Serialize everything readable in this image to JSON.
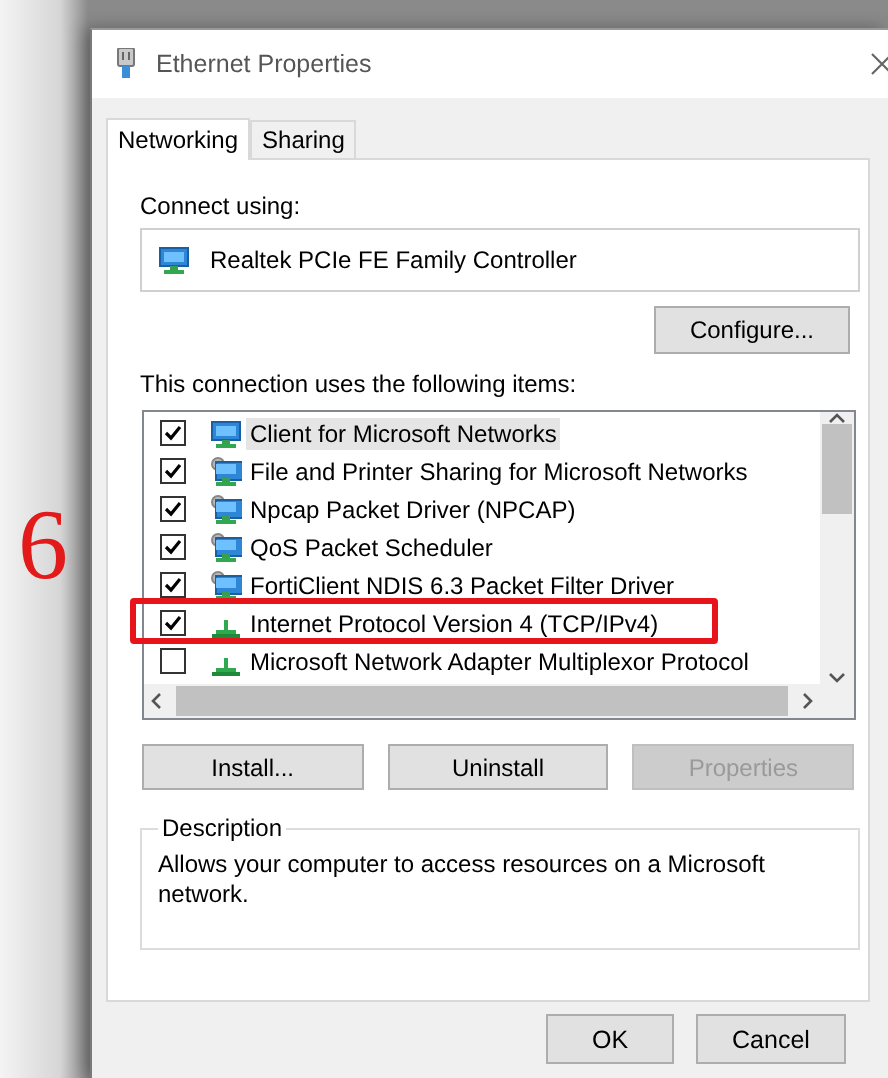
{
  "annotation": {
    "step": "6"
  },
  "window": {
    "title": "Ethernet Properties"
  },
  "tabs": [
    {
      "label": "Networking",
      "selected": true
    },
    {
      "label": "Sharing",
      "selected": false
    }
  ],
  "connect_using": {
    "label": "Connect using:",
    "adapter": "Realtek PCIe FE Family Controller"
  },
  "configure_button": "Configure...",
  "items_label": "This connection uses the following items:",
  "items": [
    {
      "label": "Client for Microsoft Networks",
      "kind": "client",
      "checked": true,
      "selected": true,
      "highlighted": false
    },
    {
      "label": "File and Printer Sharing for Microsoft Networks",
      "kind": "service",
      "checked": true,
      "selected": false,
      "highlighted": false
    },
    {
      "label": "Npcap Packet Driver (NPCAP)",
      "kind": "service",
      "checked": true,
      "selected": false,
      "highlighted": false
    },
    {
      "label": "QoS Packet Scheduler",
      "kind": "service",
      "checked": true,
      "selected": false,
      "highlighted": false
    },
    {
      "label": "FortiClient NDIS 6.3 Packet Filter Driver",
      "kind": "service",
      "checked": true,
      "selected": false,
      "highlighted": false
    },
    {
      "label": "Internet Protocol Version 4 (TCP/IPv4)",
      "kind": "protocol",
      "checked": true,
      "selected": false,
      "highlighted": true
    },
    {
      "label": "Microsoft Network Adapter Multiplexor Protocol",
      "kind": "protocol",
      "checked": false,
      "selected": false,
      "highlighted": false
    }
  ],
  "item_buttons": [
    {
      "label": "Install...",
      "disabled": false
    },
    {
      "label": "Uninstall",
      "disabled": false
    },
    {
      "label": "Properties",
      "disabled": true
    }
  ],
  "description": {
    "title": "Description",
    "text": "Allows your computer to access resources on a Microsoft network."
  },
  "buttons": [
    {
      "label": "OK"
    },
    {
      "label": "Cancel"
    }
  ]
}
